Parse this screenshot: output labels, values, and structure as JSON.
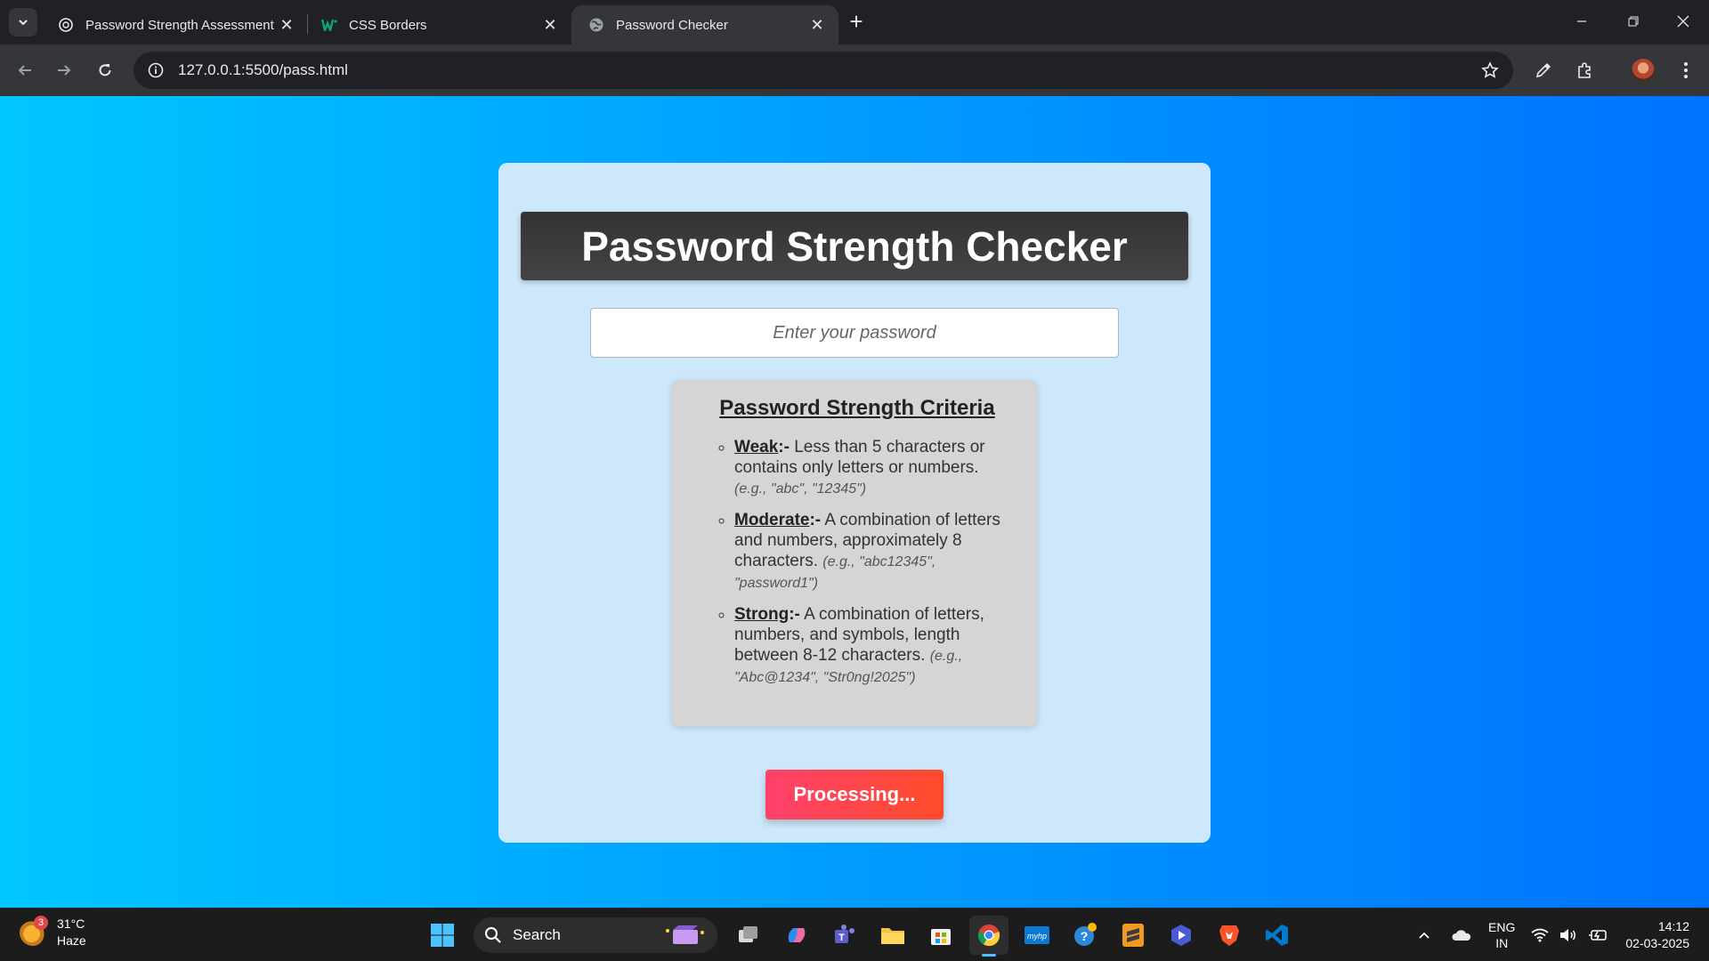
{
  "browser": {
    "tabs": [
      {
        "title": "Password Strength Assessment",
        "icon": "openai-icon",
        "active": false
      },
      {
        "title": "CSS Borders",
        "icon": "w3schools-icon",
        "active": false
      },
      {
        "title": "Password Checker",
        "icon": "globe-icon",
        "active": true
      }
    ],
    "address": "127.0.0.1:5500/pass.html"
  },
  "page": {
    "heading": "Password Strength Checker",
    "password_placeholder": "Enter your password",
    "criteria": {
      "title": "Password Strength Criteria",
      "items": [
        {
          "level": "Weak",
          "separator": ":-",
          "text": " Less than 5 characters or contains only letters or numbers. ",
          "example": "(e.g., \"abc\", \"12345\")"
        },
        {
          "level": "Moderate",
          "separator": ":-",
          "text": " A combination of letters and numbers, approximately 8 characters. ",
          "example": "(e.g., \"abc12345\", \"password1\")"
        },
        {
          "level": "Strong",
          "separator": ":-",
          "text": " A combination of letters, numbers, and symbols, length between 8-12 characters. ",
          "example": "(e.g., \"Abc@1234\", \"Str0ng!2025\")"
        }
      ]
    },
    "button_label": "Processing..."
  },
  "taskbar": {
    "weather": {
      "temp": "31°C",
      "condition": "Haze",
      "badge": "3"
    },
    "search_label": "Search",
    "tray": {
      "lang1": "ENG",
      "lang2": "IN",
      "time": "14:12",
      "date": "02-03-2025"
    }
  },
  "colors": {
    "bg_gradient_start": "#00c6ff",
    "bg_gradient_end": "#0072ff",
    "card": "#cde8fb",
    "heading_bar": "#333333",
    "button_start": "#ff416c",
    "button_end": "#ff4b2b"
  }
}
